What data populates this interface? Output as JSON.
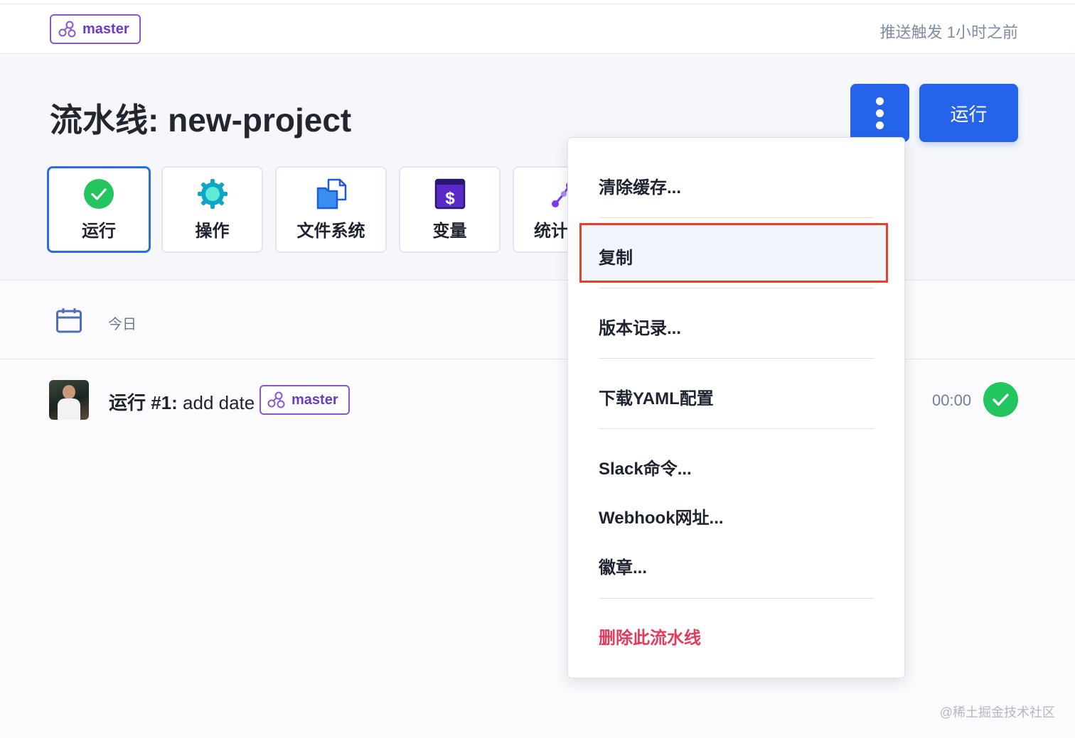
{
  "topbar": {
    "branch": "master",
    "trigger": "推送触发 1小时之前"
  },
  "header": {
    "title_prefix": "流水线: ",
    "title_name": "new-project",
    "run_button": "运行"
  },
  "tabs": [
    {
      "label": "运行",
      "icon": "check-circle-icon",
      "active": true
    },
    {
      "label": "操作",
      "icon": "gear-icon",
      "active": false
    },
    {
      "label": "文件系统",
      "icon": "files-icon",
      "active": false
    },
    {
      "label": "变量",
      "icon": "dollar-icon",
      "active": false
    },
    {
      "label": "统计",
      "icon": "stats-icon",
      "active": false
    }
  ],
  "date_row": {
    "label": "今日"
  },
  "runs": [
    {
      "title_prefix": "运行 #1:",
      "title_text": " add date",
      "branch": "master",
      "duration": "00:00",
      "status": "success"
    }
  ],
  "menu": {
    "items": [
      {
        "label": "清除缓存..."
      },
      {
        "label": "复制",
        "highlighted": true
      },
      {
        "label": "版本记录..."
      },
      {
        "label": "下载YAML配置"
      },
      {
        "label": "Slack命令..."
      },
      {
        "label": "Webhook网址..."
      },
      {
        "label": "徽章..."
      },
      {
        "label": "删除此流水线",
        "danger": true
      }
    ]
  },
  "watermark": "@稀土掘金技术社区",
  "colors": {
    "primary": "#2563eb",
    "branch": "#8a56d6",
    "success": "#22c55e",
    "danger": "#e43b5c",
    "highlight_border": "#e0432a"
  }
}
